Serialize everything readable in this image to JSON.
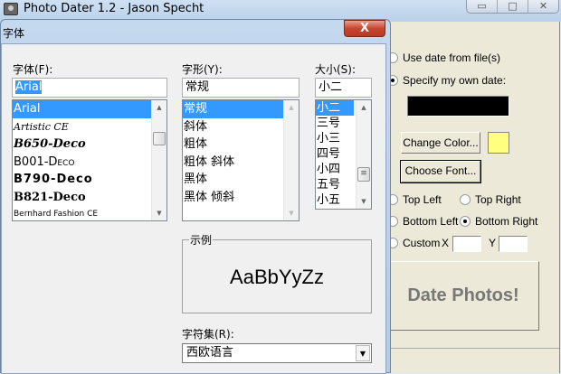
{
  "main_window": {
    "title": "Photo Dater 1.2 - Jason Specht",
    "controls": {
      "minimize": "▭",
      "maximize": "□",
      "close": "✕"
    },
    "date_source": {
      "use_file": "Use date from file(s)",
      "specify": "Specify my own date:",
      "selected": "specify"
    },
    "change_color_label": "Change Color...",
    "swatch_color": "#ffff80",
    "choose_font_label": "Choose Font...",
    "positions": {
      "top_left": "Top Left",
      "top_right": "Top Right",
      "bottom_left": "Bottom Left",
      "bottom_right": "Bottom Right",
      "custom": "Custom",
      "x_label": "X",
      "y_label": "Y",
      "selected": "bottom_right"
    },
    "date_photos_label": "Date Photos!"
  },
  "font_dialog": {
    "title": "字体",
    "close": "X",
    "font_label": "字体(F):",
    "font_value": "Arial",
    "fonts": [
      "Arial",
      "Artistic CE",
      "B650-Deco",
      "B001-Deco",
      "B790-Deco",
      "B821-Deco",
      "Bernhard Fashion CE"
    ],
    "style_label": "字形(Y):",
    "style_value": "常规",
    "styles": [
      "常规",
      "斜体",
      "粗体",
      "粗体 斜体",
      "黑体",
      "黑体 倾斜"
    ],
    "size_label": "大小(S):",
    "size_value": "小二",
    "sizes": [
      "小二",
      "三号",
      "小三",
      "四号",
      "小四",
      "五号",
      "小五"
    ],
    "sample_label": "示例",
    "sample_text": "AaBbYyZz",
    "charset_label": "字符集(R):",
    "charset_value": "西欧语言"
  }
}
